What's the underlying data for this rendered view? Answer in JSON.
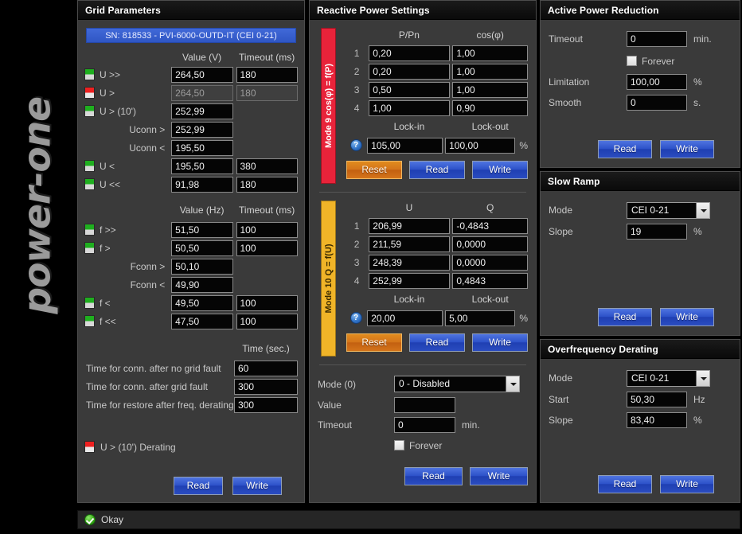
{
  "brand": {
    "logo_text": "power-one"
  },
  "status_bar": {
    "icon": "ok-check-icon",
    "text": "Okay"
  },
  "grid_parameters": {
    "title": "Grid Parameters",
    "sn_banner": "SN: 818533 - PVI-6000-OUTD-IT (CEI 0-21)",
    "voltage_headers": {
      "value": "Value (V)",
      "timeout": "Timeout (ms)"
    },
    "voltage_rows": [
      {
        "led": "green",
        "label": "U >>",
        "value": "264,50",
        "timeout": "180",
        "disabled": false,
        "has_timeout": true
      },
      {
        "led": "red",
        "label": "U >",
        "value": "264,50",
        "timeout": "180",
        "disabled": true,
        "has_timeout": true
      },
      {
        "led": "green",
        "label": "U > (10')",
        "value": "252,99",
        "timeout": "",
        "disabled": false,
        "has_timeout": false
      },
      {
        "led": "none",
        "label": "Uconn >",
        "value": "252,99",
        "timeout": "",
        "disabled": false,
        "has_timeout": false
      },
      {
        "led": "none",
        "label": "Uconn <",
        "value": "195,50",
        "timeout": "",
        "disabled": false,
        "has_timeout": false
      },
      {
        "led": "green",
        "label": "U <",
        "value": "195,50",
        "timeout": "380",
        "disabled": false,
        "has_timeout": true
      },
      {
        "led": "green",
        "label": "U <<",
        "value": "91,98",
        "timeout": "180",
        "disabled": false,
        "has_timeout": true
      }
    ],
    "freq_headers": {
      "value": "Value (Hz)",
      "timeout": "Timeout (ms)"
    },
    "freq_rows": [
      {
        "led": "green",
        "label": "f >>",
        "value": "51,50",
        "timeout": "100",
        "has_timeout": true
      },
      {
        "led": "green",
        "label": "f >",
        "value": "50,50",
        "timeout": "100",
        "has_timeout": true
      },
      {
        "led": "none",
        "label": "Fconn >",
        "value": "50,10",
        "timeout": "",
        "has_timeout": false
      },
      {
        "led": "none",
        "label": "Fconn <",
        "value": "49,90",
        "timeout": "",
        "has_timeout": false
      },
      {
        "led": "green",
        "label": "f <",
        "value": "49,50",
        "timeout": "100",
        "has_timeout": true
      },
      {
        "led": "green",
        "label": "f <<",
        "value": "47,50",
        "timeout": "100",
        "has_timeout": true
      }
    ],
    "time_header": "Time (sec.)",
    "time_rows": [
      {
        "label": "Time for conn. after no grid fault",
        "value": "60"
      },
      {
        "label": "Time for conn. after grid fault",
        "value": "300"
      },
      {
        "label": "Time for restore after freq. derating",
        "value": "300"
      }
    ],
    "derating_indicator": {
      "led": "red",
      "label": "U > (10') Derating"
    },
    "read_label": "Read",
    "write_label": "Write"
  },
  "reactive_power": {
    "title": "Reactive Power Settings",
    "mode9": {
      "bar_label": "Mode 9   cos(φ) = f(P)",
      "bar_color": "#e8233a",
      "headers": {
        "col1": "P/Pn",
        "col2": "cos(φ)"
      },
      "rows": [
        {
          "index": "1",
          "col1": "0,20",
          "col2": "1,00"
        },
        {
          "index": "2",
          "col1": "0,20",
          "col2": "1,00"
        },
        {
          "index": "3",
          "col1": "0,50",
          "col2": "1,00"
        },
        {
          "index": "4",
          "col1": "1,00",
          "col2": "0,90"
        }
      ],
      "lock_headers": {
        "lock_in": "Lock-in",
        "lock_out": "Lock-out"
      },
      "lock_in": "105,00",
      "lock_out": "100,00",
      "lock_unit": "%",
      "help_icon": "help-icon",
      "reset_label": "Reset",
      "read_label": "Read",
      "write_label": "Write"
    },
    "mode10": {
      "bar_label": "Mode 10   Q = f(U)",
      "bar_color": "#f0b428",
      "headers": {
        "col1": "U",
        "col2": "Q"
      },
      "rows": [
        {
          "index": "1",
          "col1": "206,99",
          "col2": "-0,4843"
        },
        {
          "index": "2",
          "col1": "211,59",
          "col2": "0,0000"
        },
        {
          "index": "3",
          "col1": "248,39",
          "col2": "0,0000"
        },
        {
          "index": "4",
          "col1": "252,99",
          "col2": "0,4843"
        }
      ],
      "lock_headers": {
        "lock_in": "Lock-in",
        "lock_out": "Lock-out"
      },
      "lock_in": "20,00",
      "lock_out": "5,00",
      "lock_unit": "%",
      "help_icon": "help-icon",
      "reset_label": "Reset",
      "read_label": "Read",
      "write_label": "Write"
    },
    "mode0": {
      "mode_label": "Mode (0)",
      "mode_value": "0 - Disabled",
      "value_label": "Value",
      "value_value": "",
      "timeout_label": "Timeout",
      "timeout_value": "0",
      "timeout_unit": "min.",
      "forever_label": "Forever",
      "forever_checked": false,
      "read_label": "Read",
      "write_label": "Write"
    }
  },
  "active_power_reduction": {
    "title": "Active Power Reduction",
    "timeout_label": "Timeout",
    "timeout_value": "0",
    "timeout_unit": "min.",
    "forever_label": "Forever",
    "forever_checked": false,
    "limitation_label": "Limitation",
    "limitation_value": "100,00",
    "limitation_unit": "%",
    "smooth_label": "Smooth",
    "smooth_value": "0",
    "smooth_unit": "s.",
    "read_label": "Read",
    "write_label": "Write"
  },
  "slow_ramp": {
    "title": "Slow Ramp",
    "mode_label": "Mode",
    "mode_value": "CEI 0-21",
    "slope_label": "Slope",
    "slope_value": "19",
    "slope_unit": "%",
    "read_label": "Read",
    "write_label": "Write"
  },
  "overfrequency_derating": {
    "title": "Overfrequency Derating",
    "mode_label": "Mode",
    "mode_value": "CEI 0-21",
    "start_label": "Start",
    "start_value": "50,30",
    "start_unit": "Hz",
    "slope_label": "Slope",
    "slope_value": "83,40",
    "slope_unit": "%",
    "read_label": "Read",
    "write_label": "Write"
  }
}
